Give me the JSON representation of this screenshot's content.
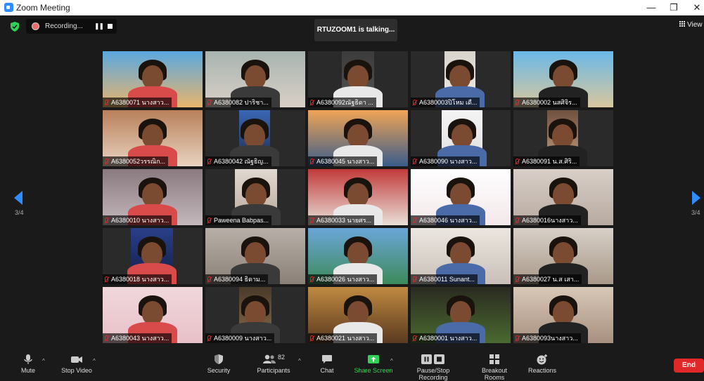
{
  "window": {
    "title": "Zoom Meeting",
    "minimize": "—",
    "restore": "❐",
    "close": "✕"
  },
  "recording": {
    "label": "Recording...",
    "pause_glyph": "❚❚"
  },
  "talking_banner": "RTUZOOM1 is talking...",
  "view_label": "View",
  "page_indicator": {
    "left": "3/4",
    "right": "3/4"
  },
  "participants": [
    {
      "name": "A6380071 นางสาว..."
    },
    {
      "name": "A6380082 ปาริชา..."
    },
    {
      "name": "A6380092ณัฐธิดา ..."
    },
    {
      "name": "A6380003ปิโหม เดื..."
    },
    {
      "name": "A6380002 นสศิจิร..."
    },
    {
      "name": "A6380052วรรณิก..."
    },
    {
      "name": "A6380042 ณัฐธิญ..."
    },
    {
      "name": "A6380045 นางสาว..."
    },
    {
      "name": "A6380090 นางสาว..."
    },
    {
      "name": "A6380091 น.ส.ศิริ..."
    },
    {
      "name": "A6380010 นางสาว..."
    },
    {
      "name": "Paweena Babpas..."
    },
    {
      "name": "A6380033 นายศร..."
    },
    {
      "name": "A6380046 นางสาว..."
    },
    {
      "name": "A6380016นางสาว..."
    },
    {
      "name": "A6380018 นางสาว..."
    },
    {
      "name": "A6380094 ธิดาม..."
    },
    {
      "name": "A6380026 นางสาว..."
    },
    {
      "name": "A6380011 Sunant..."
    },
    {
      "name": "A6380027 น.ส เสา..."
    },
    {
      "name": "A6380043 นางสาว..."
    },
    {
      "name": "A6380009 นางสาว..."
    },
    {
      "name": "A6380021 นางสาว..."
    },
    {
      "name": "A6380001 นางสาว..."
    },
    {
      "name": "A6380093นางสาว..."
    }
  ],
  "toolbar": {
    "mute": "Mute",
    "stop_video": "Stop Video",
    "security": "Security",
    "participants": "Participants",
    "participants_count": "82",
    "chat": "Chat",
    "share_screen": "Share Screen",
    "pause_recording": "Pause/Stop Recording",
    "breakout_rooms": "Breakout Rooms",
    "reactions": "Reactions",
    "end": "End",
    "caret": "^"
  },
  "colors": {
    "accent": "#2d8cff",
    "share": "#31d158",
    "end": "#e02828",
    "shield": "#31d158"
  }
}
